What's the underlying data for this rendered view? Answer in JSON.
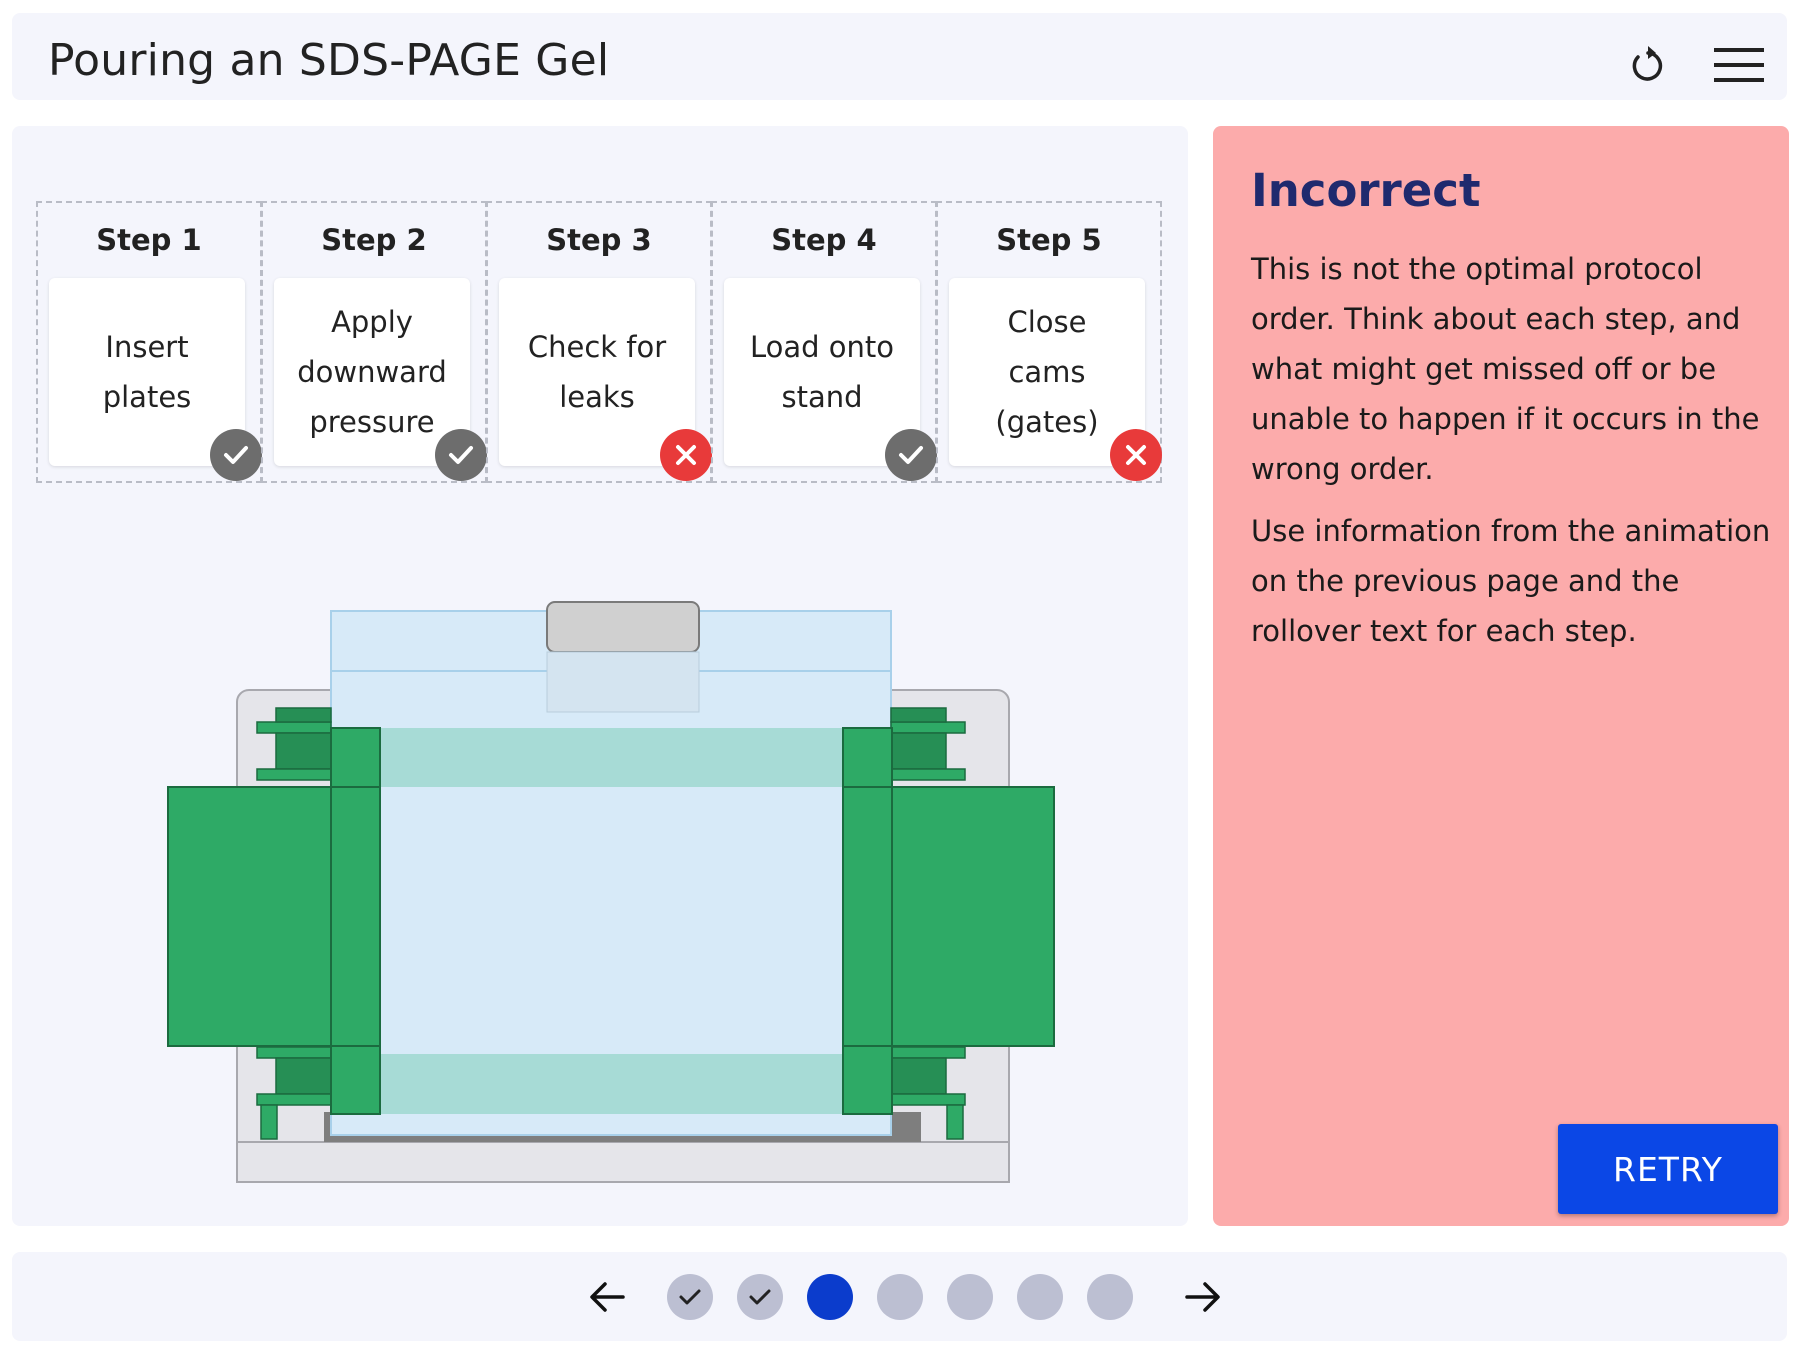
{
  "header": {
    "title": "Pouring an SDS-PAGE Gel",
    "refresh_icon": "refresh-icon",
    "menu_icon": "hamburger-menu-icon"
  },
  "steps": [
    {
      "heading": "Step 1",
      "label": "Insert plates",
      "status": "correct"
    },
    {
      "heading": "Step 2",
      "label": "Apply downward pressure",
      "status": "correct"
    },
    {
      "heading": "Step 3",
      "label": "Check for leaks",
      "status": "incorrect"
    },
    {
      "heading": "Step 4",
      "label": "Load onto stand",
      "status": "correct"
    },
    {
      "heading": "Step 5",
      "label": "Close cams (gates)",
      "status": "incorrect"
    }
  ],
  "feedback": {
    "title": "Incorrect",
    "paragraph1": "This is not the optimal protocol order. Think about each step, and what might get missed off or be unable to happen if it occurs in the wrong order.",
    "paragraph2": "Use information from the animation on the previous page and the rollover text for each step.",
    "retry_label": "RETRY",
    "background_color": "#fcabab",
    "title_color": "#1f2a6e",
    "button_color": "#0b47e6"
  },
  "pagination": {
    "prev_icon": "arrow-left-icon",
    "next_icon": "arrow-right-icon",
    "pages": [
      {
        "status": "completed"
      },
      {
        "status": "completed"
      },
      {
        "status": "current"
      },
      {
        "status": "upcoming"
      },
      {
        "status": "upcoming"
      },
      {
        "status": "upcoming"
      },
      {
        "status": "upcoming"
      }
    ],
    "current_color": "#0b3ccc",
    "inactive_color": "#bcbfd2"
  },
  "colors": {
    "status_correct": "#6d6d6d",
    "status_incorrect": "#e83a3a",
    "clamp_green": "#2eaa66"
  }
}
